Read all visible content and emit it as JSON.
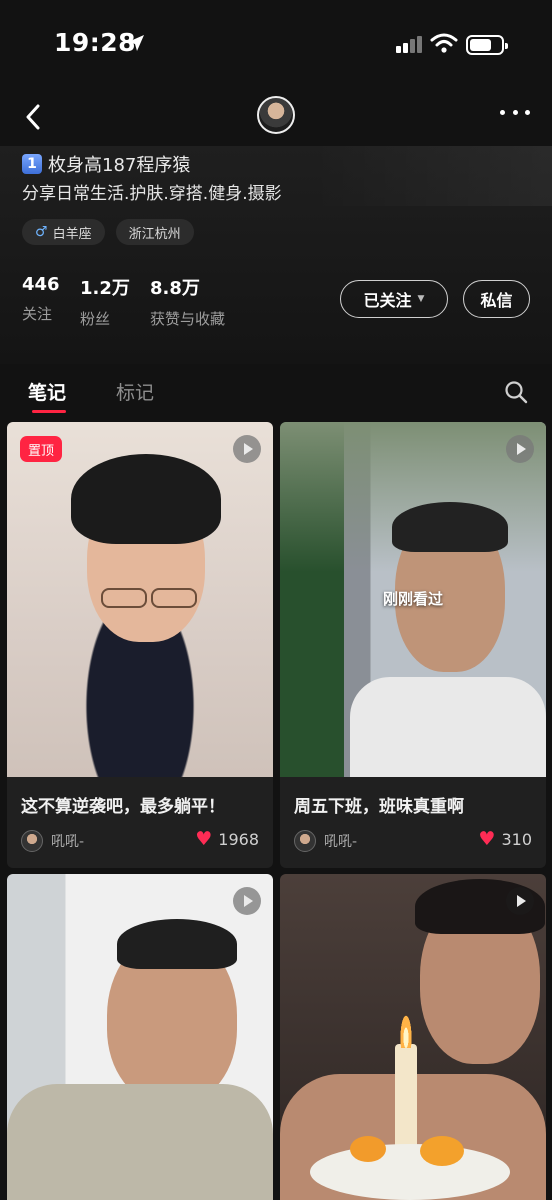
{
  "status_bar": {
    "time": "19:28"
  },
  "profile": {
    "name_badge": "1",
    "name": "枚身高187程序猿",
    "bio": "分享日常生活.护肤.穿搭.健身.摄影",
    "tags": [
      "白羊座",
      "浙江杭州"
    ],
    "stats": [
      {
        "value": "446",
        "label": "关注"
      },
      {
        "value": "1.2万",
        "label": "粉丝"
      },
      {
        "value": "8.8万",
        "label": "获赞与收藏"
      }
    ],
    "follow_label": "已关注",
    "message_label": "私信"
  },
  "tabs": {
    "notes": "笔记",
    "marks": "标记"
  },
  "cards": [
    {
      "title": "这不算逆袭吧，最多躺平！",
      "author": "吼吼-",
      "likes": "1968",
      "pinned_label": "置顶"
    },
    {
      "title": "周五下班，班味真重啊",
      "author": "吼吼-",
      "likes": "310",
      "overlay": "刚刚看过"
    },
    {
      "title": "",
      "author": "",
      "likes": ""
    },
    {
      "title": "",
      "author": "",
      "likes": ""
    }
  ],
  "colors": {
    "accent": "#ff2442",
    "background": "#121212",
    "card": "#202020"
  }
}
